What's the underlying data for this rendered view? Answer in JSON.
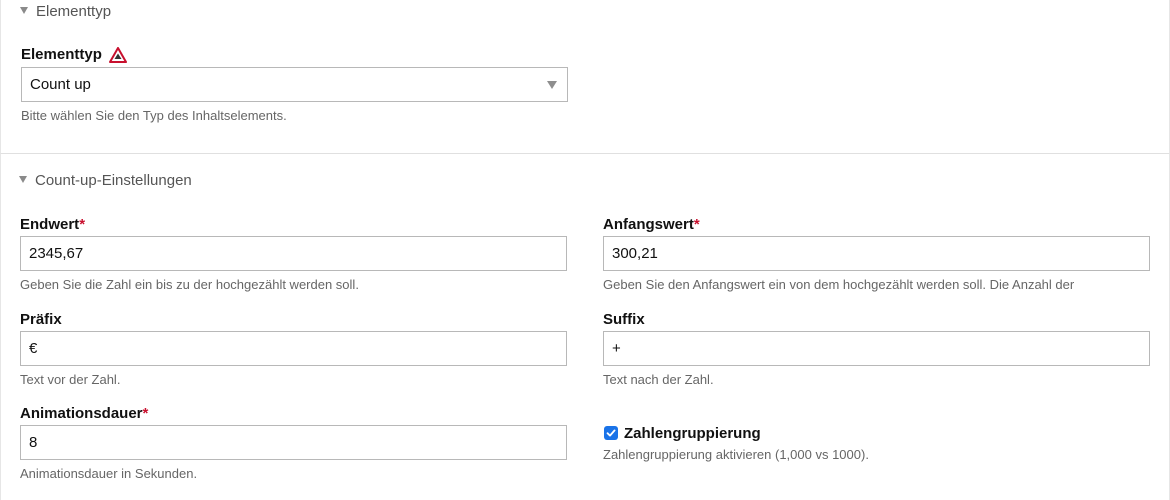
{
  "element_type_section": {
    "legend": "Elementtyp",
    "field_label": "Elementtyp",
    "selected_value": "Count up",
    "help": "Bitte wählen Sie den Typ des Inhaltselements."
  },
  "countup_section": {
    "legend": "Count-up-Einstellungen",
    "end_value": {
      "label": "Endwert",
      "required_mark": "*",
      "value": "2345,67",
      "help": "Geben Sie die Zahl ein bis zu der hochgezählt werden soll."
    },
    "start_value": {
      "label": "Anfangswert",
      "required_mark": "*",
      "value": "300,21",
      "help": "Geben Sie den Anfangswert ein von dem hochgezählt werden soll. Die Anzahl der"
    },
    "prefix": {
      "label": "Präfix",
      "value": "€",
      "help": "Text vor der Zahl."
    },
    "suffix": {
      "label": "Suffix",
      "value": "+",
      "help": "Text nach der Zahl."
    },
    "duration": {
      "label": "Animationsdauer",
      "required_mark": "*",
      "value": "8",
      "help": "Animationsdauer in Sekunden."
    },
    "grouping": {
      "label": "Zahlengruppierung",
      "checked": true,
      "help": "Zahlengruppierung aktivieren (1,000 vs 1000)."
    }
  },
  "colors": {
    "required": "#c8102e",
    "checkbox": "#1a73e8",
    "warning": "#c8102e"
  }
}
